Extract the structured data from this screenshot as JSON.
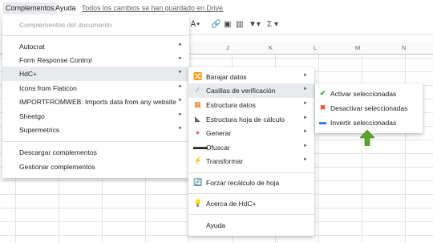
{
  "menubar": {
    "complementos": "Complementos",
    "ayuda": "Ayuda",
    "saved": "Todos los cambios se han guardado en Drive"
  },
  "columns": [
    "J",
    "K",
    "L",
    "M",
    "N"
  ],
  "main_menu": {
    "items": [
      {
        "label": "Complementos del documento",
        "disabled": true
      },
      {
        "label": "Autocrat"
      },
      {
        "label": "Form Response Control"
      },
      {
        "label": "HdC+"
      },
      {
        "label": "Icons from Flaticon"
      },
      {
        "label": "IMPORTFROMWEB: Imports data from any website"
      },
      {
        "label": "Sheetgo"
      },
      {
        "label": "Supermetrics"
      },
      {
        "label": "Descargar complementos"
      },
      {
        "label": "Gestionar complementos"
      }
    ]
  },
  "sub_menu": {
    "items": [
      {
        "label": "Barajar datos",
        "icon": "shuffle-icon"
      },
      {
        "label": "Casillas de verificación",
        "icon": "checkbox-icon"
      },
      {
        "label": "Estructura datos",
        "icon": "structure-icon"
      },
      {
        "label": "Estructura hoja de cálculo",
        "icon": "sheet-icon"
      },
      {
        "label": "Generar",
        "icon": "brain-icon"
      },
      {
        "label": "Ofuscar",
        "icon": "sunglasses-icon"
      },
      {
        "label": "Transformar",
        "icon": "lightning-icon"
      },
      {
        "label": "Forzar recálculo de hoja",
        "icon": "refresh-icon"
      },
      {
        "label": "Acerca de HdC+",
        "icon": "bulb-icon"
      },
      {
        "label": "Ayuda"
      }
    ]
  },
  "sub2_menu": {
    "items": [
      {
        "label": "Activar seleccionadas",
        "icon": "check-icon"
      },
      {
        "label": "Desactivar seleccionadas",
        "icon": "x-icon"
      },
      {
        "label": "Invertir seleccionadas",
        "icon": "minus-icon"
      }
    ]
  },
  "colors": {
    "accent_green": "#5aa52a",
    "check_green": "#34a853",
    "x_red": "#ea4335",
    "minus_blue": "#1a73e8"
  }
}
